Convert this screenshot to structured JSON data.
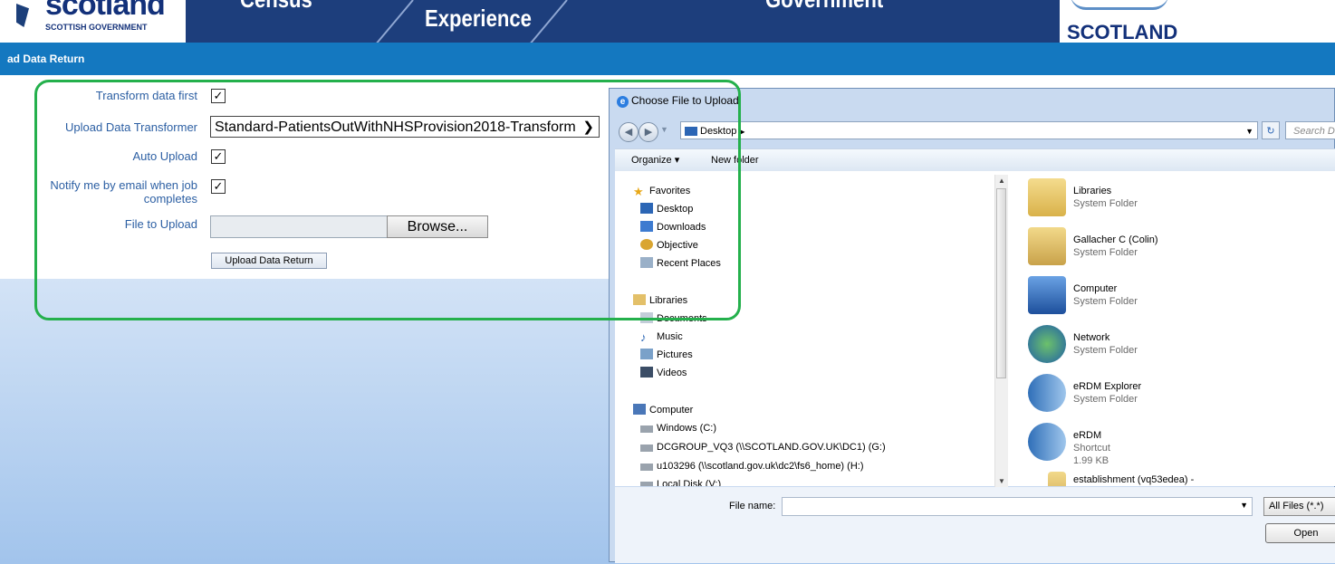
{
  "banner": {
    "logo_left": {
      "big": "scotland",
      "small": "SCOTTISH GOVERNMENT"
    },
    "tabs": [
      "Census",
      "Experience",
      "Government"
    ],
    "logo_right": "SCOTLAND"
  },
  "titlebar": "ad Data Return",
  "form": {
    "transform_label": "Transform data first",
    "transformer_label": "Upload Data Transformer",
    "transformer_value": "Standard-PatientsOutWithNHSProvision2018-Transform",
    "auto_upload_label": "Auto Upload",
    "notify_label_1": "Notify me by email when job",
    "notify_label_2": "completes",
    "file_label": "File to Upload",
    "browse_label": "Browse...",
    "upload_button": "Upload Data Return",
    "checkmark": "✓"
  },
  "dialog": {
    "title": "Choose File to Upload",
    "address": "Desktop",
    "search_placeholder": "Search Deskt",
    "organize": "Organize ▾",
    "new_folder": "New folder",
    "nav": {
      "favorites": "Favorites",
      "desktop": "Desktop",
      "downloads": "Downloads",
      "objective": "Objective",
      "recent": "Recent Places",
      "libraries": "Libraries",
      "documents": "Documents",
      "music": "Music",
      "pictures": "Pictures",
      "videos": "Videos",
      "computer": "Computer",
      "windows": "Windows (C:)",
      "dcgroup": "DCGROUP_VQ3 (\\\\SCOTLAND.GOV.UK\\DC1) (G:)",
      "home": "u103296 (\\\\scotland.gov.uk\\dc2\\fs6_home) (H:)",
      "local": "Local Disk (V:)"
    },
    "files": [
      {
        "name": "Libraries",
        "sub": "System Folder"
      },
      {
        "name": "Gallacher C (Colin)",
        "sub": "System Folder"
      },
      {
        "name": "Computer",
        "sub": "System Folder"
      },
      {
        "name": "Network",
        "sub": "System Folder"
      },
      {
        "name": "eRDM Explorer",
        "sub": "System Folder"
      },
      {
        "name": "eRDM",
        "sub": "Shortcut",
        "size": "1.99 KB"
      },
      {
        "name": "establishment (vq53edea) -",
        "sub": ""
      }
    ],
    "filename_label": "File name:",
    "filter": "All Files (*.*)",
    "open": "Open"
  },
  "colors": {
    "banner_navy": "#1d3e7c",
    "titlebar": "#1478c0",
    "annotation": "#24b04c",
    "link": "#2c5fa3"
  }
}
